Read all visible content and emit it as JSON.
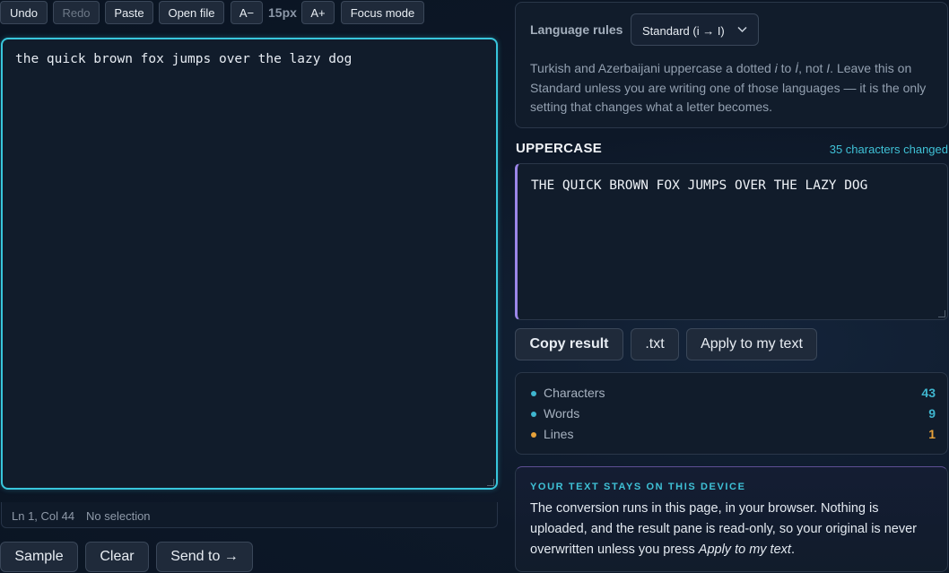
{
  "toolbar": {
    "undo": "Undo",
    "redo": "Redo",
    "paste": "Paste",
    "open_file": "Open file",
    "font_decrease": "A−",
    "font_size": "15px",
    "font_increase": "A+",
    "focus_mode": "Focus mode"
  },
  "editor": {
    "text": "the quick brown fox jumps over the lazy dog"
  },
  "status": {
    "position": "Ln 1, Col 44",
    "selection": "No selection"
  },
  "bottom_actions": {
    "sample": "Sample",
    "clear": "Clear",
    "send_to": "Send to →"
  },
  "language_rules": {
    "label": "Language rules",
    "selected": "Standard (i → I)",
    "description_pre": "Turkish and Azerbaijani uppercase a dotted ",
    "dotted_i": "i",
    "to_word": " to ",
    "dotted_I": "İ",
    "not_word": ", not ",
    "plain_I": "I",
    "description_post": ". Leave this on Standard unless you are writing one of those languages — it is the only setting that changes what a letter becomes."
  },
  "result": {
    "title": "UPPERCASE",
    "changed": "35 characters changed",
    "text": "THE QUICK BROWN FOX JUMPS OVER THE LAZY DOG"
  },
  "result_actions": {
    "copy": "Copy result",
    "txt": ".txt",
    "apply": "Apply to my text"
  },
  "stats": [
    {
      "label": "Characters",
      "value": "43",
      "color": "#3fb6cf"
    },
    {
      "label": "Words",
      "value": "9",
      "color": "#3fb6cf"
    },
    {
      "label": "Lines",
      "value": "1",
      "color": "#e8a23a"
    }
  ],
  "privacy": {
    "heading": "YOUR TEXT STAYS ON THIS DEVICE",
    "body_pre": "The conversion runs in this page, in your browser. Nothing is uploaded, and the result pane is read-only, so your original is never overwritten unless you press ",
    "body_em": "Apply to my text",
    "body_post": "."
  },
  "colors": {
    "accent_cyan": "#38c6dc",
    "accent_purple": "#9b86e8",
    "background": "#0d1828"
  }
}
